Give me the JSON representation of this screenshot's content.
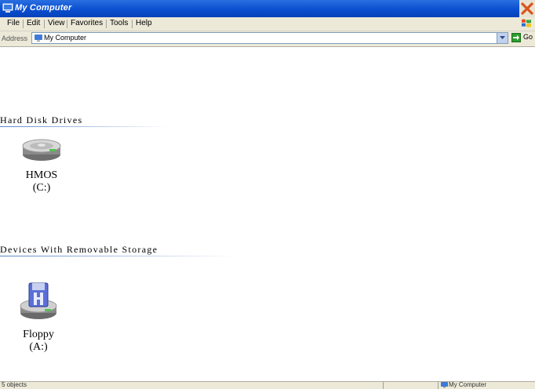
{
  "window": {
    "title": "My Computer"
  },
  "menubar": {
    "items": [
      "File",
      "Edit",
      "View",
      "Favorites",
      "Tools",
      "Help"
    ]
  },
  "address": {
    "label": "Address",
    "value": "My Computer",
    "go_label": "Go"
  },
  "sections": {
    "hard_disks": {
      "title": "Hard Disk Drives",
      "drives": [
        {
          "name": "HMOS",
          "letter": "(C:)",
          "icon": "hard-drive-icon"
        }
      ]
    },
    "removable": {
      "title": "Devices With Removable Storage",
      "drives": [
        {
          "name": "Floppy",
          "letter": "(A:)",
          "icon": "floppy-drive-icon"
        }
      ]
    }
  },
  "statusbar": {
    "left_text": "5 objects",
    "right_text": "My Computer"
  },
  "colors": {
    "titlebar": "#0a4fd0",
    "close_button": "#d8531e",
    "section_line": "#5a84c8"
  }
}
